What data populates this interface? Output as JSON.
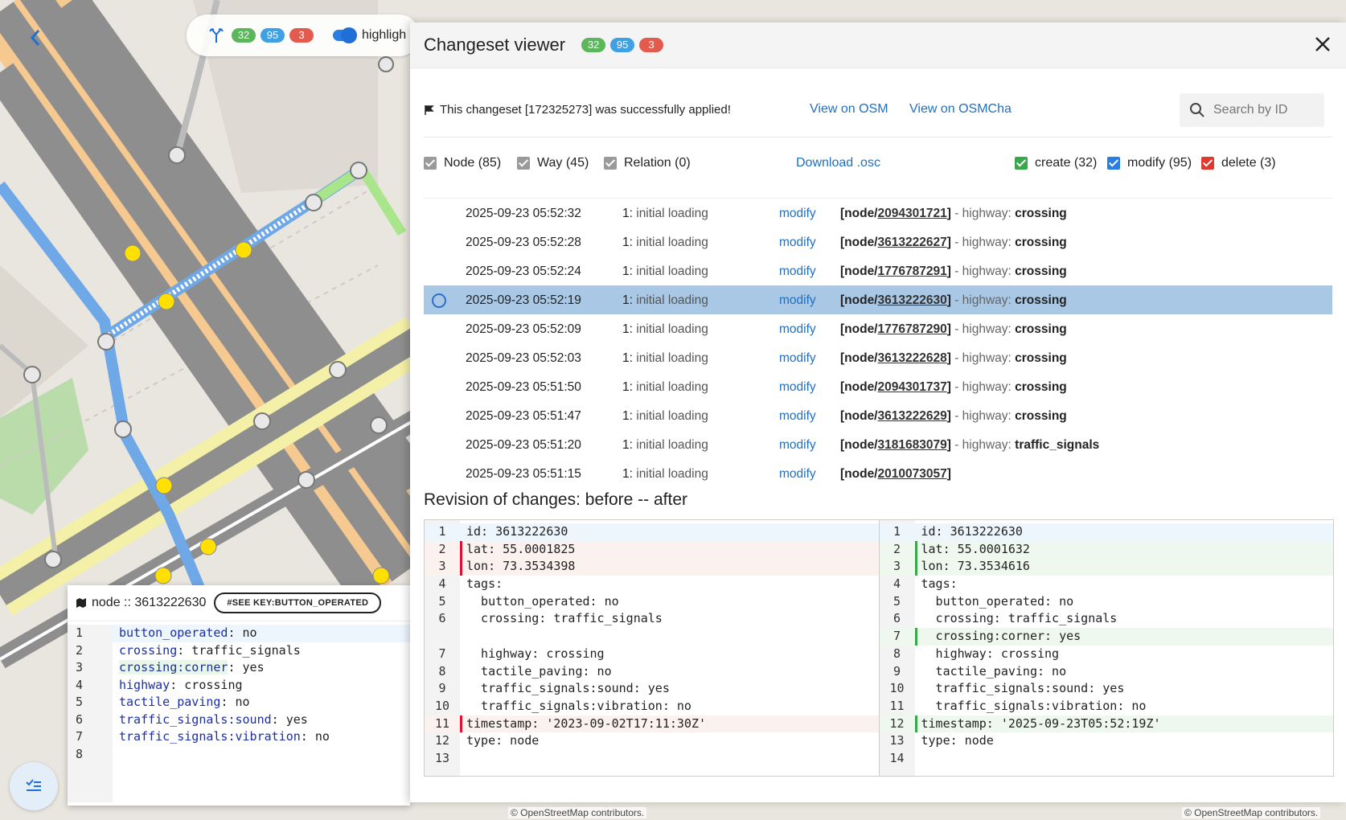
{
  "toolbar": {
    "badges": [
      "32",
      "95",
      "3"
    ],
    "label": "highligh"
  },
  "node_panel": {
    "title": "node :: 3613222630",
    "pill": "#SEE KEY:BUTTON_OPERATED",
    "lines": [
      {
        "n": "1",
        "k": "button_operated",
        "v": ": no"
      },
      {
        "n": "2",
        "k": "crossing",
        "v": ": traffic_signals"
      },
      {
        "n": "3",
        "k": "crossing:corner",
        "v": ": yes"
      },
      {
        "n": "4",
        "k": "highway",
        "v": ": crossing"
      },
      {
        "n": "5",
        "k": "tactile_paving",
        "v": ": no"
      },
      {
        "n": "6",
        "k": "traffic_signals:sound",
        "v": ": yes"
      },
      {
        "n": "7",
        "k": "traffic_signals:vibration",
        "v": ": no"
      },
      {
        "n": "8",
        "k": "",
        "v": ""
      }
    ]
  },
  "viewer": {
    "title": "Changeset viewer",
    "badges": [
      "32",
      "95",
      "3"
    ],
    "status": "This changeset [172325273] was successfully applied!",
    "link_osm": "View on OSM",
    "link_osmcha": "View on OSMCha",
    "search_placeholder": "Search by ID",
    "filters": {
      "node": "Node (85)",
      "way": "Way (45)",
      "relation": "Relation (0)",
      "download": "Download .osc",
      "create": "create (32)",
      "modify": "modify (95)",
      "delete": "delete (3)"
    },
    "rows": [
      {
        "time": "2025-09-23 05:52:32",
        "cs_num": "1:",
        "cs": " initial loading",
        "action": "modify",
        "obj_pre": "[node/",
        "obj_id": "2094301721",
        "obj_post": "]",
        "tag_k": " - highway: ",
        "tag_v": "crossing"
      },
      {
        "time": "2025-09-23 05:52:28",
        "cs_num": "1:",
        "cs": " initial loading",
        "action": "modify",
        "obj_pre": "[node/",
        "obj_id": "3613222627",
        "obj_post": "]",
        "tag_k": " - highway: ",
        "tag_v": "crossing"
      },
      {
        "time": "2025-09-23 05:52:24",
        "cs_num": "1:",
        "cs": " initial loading",
        "action": "modify",
        "obj_pre": "[node/",
        "obj_id": "1776787291",
        "obj_post": "]",
        "tag_k": " - highway: ",
        "tag_v": "crossing"
      },
      {
        "time": "2025-09-23 05:52:19",
        "cs_num": "1:",
        "cs": " initial loading",
        "action": "modify",
        "obj_pre": "[node/",
        "obj_id": "3613222630",
        "obj_post": "]",
        "tag_k": " - highway: ",
        "tag_v": "crossing"
      },
      {
        "time": "2025-09-23 05:52:09",
        "cs_num": "1:",
        "cs": " initial loading",
        "action": "modify",
        "obj_pre": "[node/",
        "obj_id": "1776787290",
        "obj_post": "]",
        "tag_k": " - highway: ",
        "tag_v": "crossing"
      },
      {
        "time": "2025-09-23 05:52:03",
        "cs_num": "1:",
        "cs": " initial loading",
        "action": "modify",
        "obj_pre": "[node/",
        "obj_id": "3613222628",
        "obj_post": "]",
        "tag_k": " - highway: ",
        "tag_v": "crossing"
      },
      {
        "time": "2025-09-23 05:51:50",
        "cs_num": "1:",
        "cs": " initial loading",
        "action": "modify",
        "obj_pre": "[node/",
        "obj_id": "2094301737",
        "obj_post": "]",
        "tag_k": " - highway: ",
        "tag_v": "crossing"
      },
      {
        "time": "2025-09-23 05:51:47",
        "cs_num": "1:",
        "cs": " initial loading",
        "action": "modify",
        "obj_pre": "[node/",
        "obj_id": "3613222629",
        "obj_post": "]",
        "tag_k": " - highway: ",
        "tag_v": "crossing"
      },
      {
        "time": "2025-09-23 05:51:20",
        "cs_num": "1:",
        "cs": " initial loading",
        "action": "modify",
        "obj_pre": "[node/",
        "obj_id": "3181683079",
        "obj_post": "]",
        "tag_k": " - highway: ",
        "tag_v": "traffic_signals"
      },
      {
        "time": "2025-09-23 05:51:15",
        "cs_num": "1:",
        "cs": " initial loading",
        "action": "modify",
        "obj_pre": "[node/",
        "obj_id": "2010073057",
        "obj_post": "]",
        "tag_k": "",
        "tag_v": ""
      }
    ],
    "revision_title": "Revision of changes: before -- after",
    "before": [
      {
        "n": "1",
        "t": "id: 3613222630",
        "s": "first"
      },
      {
        "n": "2",
        "t": "lat: 55.0001825",
        "s": "rem"
      },
      {
        "n": "3",
        "t": "lon: 73.3534398",
        "s": "rem"
      },
      {
        "n": "4",
        "t": "tags:",
        "s": ""
      },
      {
        "n": "5",
        "t": "  button_operated: no",
        "s": ""
      },
      {
        "n": "6",
        "t": "  crossing: traffic_signals",
        "s": ""
      },
      {
        "n": "",
        "t": "",
        "s": ""
      },
      {
        "n": "7",
        "t": "  highway: crossing",
        "s": ""
      },
      {
        "n": "8",
        "t": "  tactile_paving: no",
        "s": ""
      },
      {
        "n": "9",
        "t": "  traffic_signals:sound: yes",
        "s": ""
      },
      {
        "n": "10",
        "t": "  traffic_signals:vibration: no",
        "s": ""
      },
      {
        "n": "11",
        "t": "timestamp: '2023-09-02T17:11:30Z'",
        "s": "rem"
      },
      {
        "n": "12",
        "t": "type: node",
        "s": ""
      },
      {
        "n": "13",
        "t": "",
        "s": ""
      }
    ],
    "after": [
      {
        "n": "1",
        "t": "id: 3613222630",
        "s": "first"
      },
      {
        "n": "2",
        "t": "lat: 55.0001632",
        "s": "add"
      },
      {
        "n": "3",
        "t": "lon: 73.3534616",
        "s": "add"
      },
      {
        "n": "4",
        "t": "tags:",
        "s": ""
      },
      {
        "n": "5",
        "t": "  button_operated: no",
        "s": ""
      },
      {
        "n": "6",
        "t": "  crossing: traffic_signals",
        "s": ""
      },
      {
        "n": "7",
        "t": "  crossing:corner: yes",
        "s": "add"
      },
      {
        "n": "8",
        "t": "  highway: crossing",
        "s": ""
      },
      {
        "n": "9",
        "t": "  tactile_paving: no",
        "s": ""
      },
      {
        "n": "10",
        "t": "  traffic_signals:sound: yes",
        "s": ""
      },
      {
        "n": "11",
        "t": "  traffic_signals:vibration: no",
        "s": ""
      },
      {
        "n": "12",
        "t": "timestamp: '2025-09-23T05:52:19Z'",
        "s": "add"
      },
      {
        "n": "13",
        "t": "type: node",
        "s": ""
      },
      {
        "n": "14",
        "t": "",
        "s": ""
      }
    ],
    "selected_row": 3
  },
  "attribution": "© OpenStreetMap contributors.",
  "colors": {
    "accent": "#2a7de1",
    "selected_row": "#a9c8e6",
    "create": "#3aa84a",
    "delete": "#e0392d"
  }
}
